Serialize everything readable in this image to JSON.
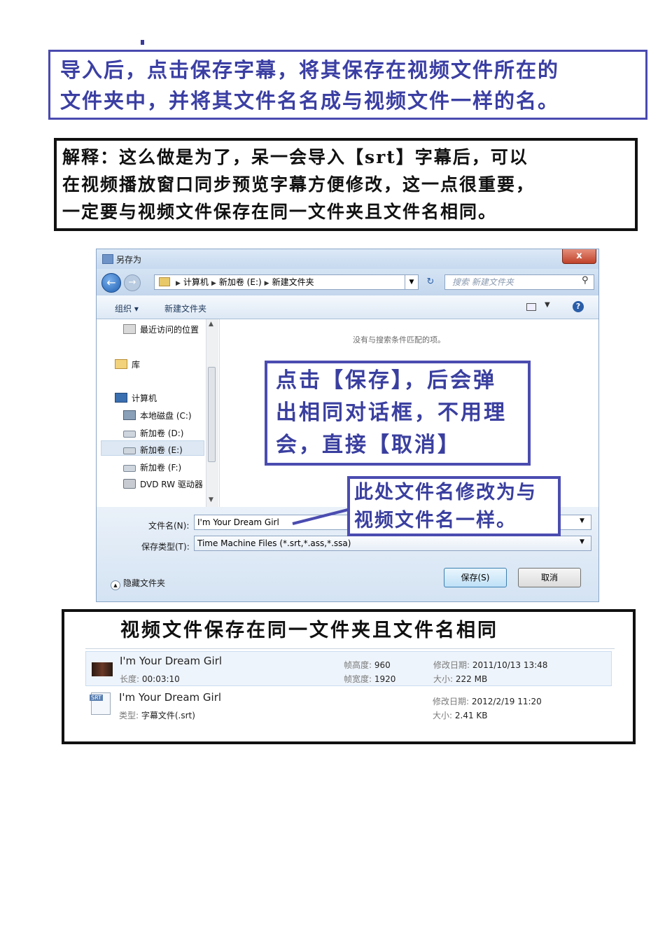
{
  "notes": {
    "top_line1": "导入后，点击保存字幕，将其保存在视频文件所在的",
    "top_line2": "文件夹中，并将其文件名名成与视频文件一样的名。",
    "explain_line1": "解释：这么做是为了，呆一会导入【srt】字幕后，可以",
    "explain_line2": "在视频播放窗口同步预览字幕方便修改，这一点很重要，",
    "explain_line3": "一定要与视频文件保存在同一文件夹且文件名相同。"
  },
  "dialog": {
    "title": "另存为",
    "close_symbol": "x",
    "breadcrumb": [
      "计算机",
      "新加卷 (E:)",
      "新建文件夹"
    ],
    "search_placeholder": "搜索 新建文件夹",
    "toolbar": {
      "organize": "组织 ▾",
      "new_folder": "新建文件夹"
    },
    "nav_items": [
      {
        "label": "最近访问的位置",
        "icon": "recent-places-icon"
      },
      {
        "label": "库",
        "icon": "library-icon"
      },
      {
        "label": "计算机",
        "icon": "computer-icon"
      },
      {
        "label": "本地磁盘 (C:)",
        "icon": "system-disk-icon"
      },
      {
        "label": "新加卷 (D:)",
        "icon": "drive-icon"
      },
      {
        "label": "新加卷 (E:)",
        "icon": "drive-icon",
        "selected": true
      },
      {
        "label": "新加卷 (F:)",
        "icon": "drive-icon"
      },
      {
        "label": "DVD RW 驱动器",
        "icon": "dvd-drive-icon"
      }
    ],
    "empty_message": "没有与搜索条件匹配的项。",
    "filename_label": "文件名(N):",
    "filename_value": "I'm Your Dream Girl",
    "filetype_label": "保存类型(T):",
    "filetype_value": "Time Machine Files (*.srt,*.ass,*.ssa)",
    "hide_folders": "隐藏文件夹",
    "save_button": "保存(S)",
    "cancel_button": "取消"
  },
  "callouts": {
    "save_line1": "点击【保存】，后会弹",
    "save_line2": "出相同对话框，不用理",
    "save_line3": "会，直接【取消】",
    "name_line1": "此处文件名修改为与",
    "name_line2": "视频文件名一样。"
  },
  "listing": {
    "heading": "视频文件保存在同一文件夹且文件名相同",
    "files": [
      {
        "name": "I'm Your Dream Girl",
        "icon": "video-thumbnail-icon",
        "meta1_key": "长度:",
        "meta1_val": "00:03:10",
        "meta2_key": "帧高度:",
        "meta2_val": "960",
        "meta3_key": "帧宽度:",
        "meta3_val": "1920",
        "meta4_key": "修改日期:",
        "meta4_val": "2011/10/13 13:48",
        "meta5_key": "大小:",
        "meta5_val": "222 MB"
      },
      {
        "name": "I'm Your Dream Girl",
        "icon": "srt-file-icon",
        "icon_tag": "SRT",
        "meta1_key": "类型:",
        "meta1_val": "字幕文件(.srt)",
        "meta4_key": "修改日期:",
        "meta4_val": "2012/2/19 11:20",
        "meta5_key": "大小:",
        "meta5_val": "2.41 KB"
      }
    ]
  },
  "colors": {
    "annotation_blue": "#3b3fa3",
    "close_red": "#c0422b",
    "dialog_frame": "#cfe0f3"
  }
}
